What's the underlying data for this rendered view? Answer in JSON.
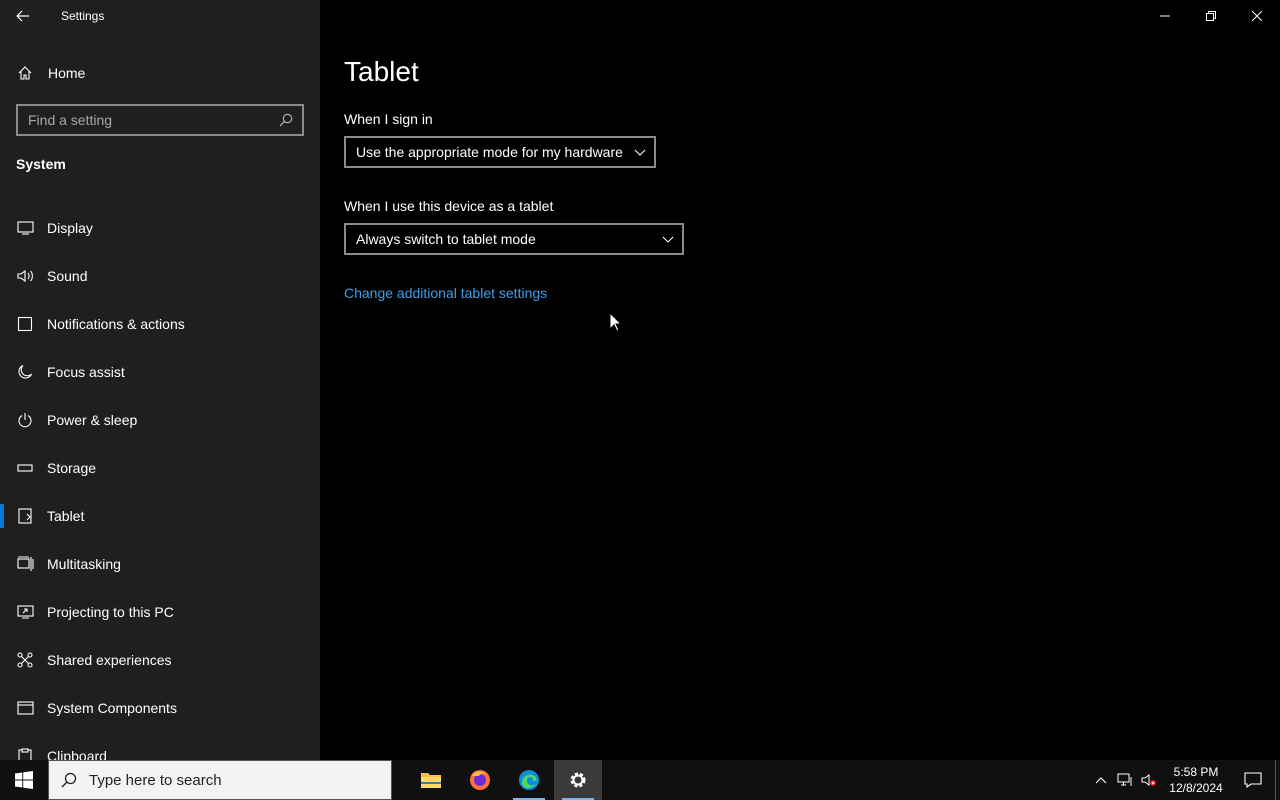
{
  "window": {
    "title": "Settings"
  },
  "sidebar": {
    "home_label": "Home",
    "search_placeholder": "Find a setting",
    "section": "System",
    "items": [
      {
        "label": "Display",
        "icon": "display-icon"
      },
      {
        "label": "Sound",
        "icon": "sound-icon"
      },
      {
        "label": "Notifications & actions",
        "icon": "notifications-icon"
      },
      {
        "label": "Focus assist",
        "icon": "moon-icon"
      },
      {
        "label": "Power & sleep",
        "icon": "power-icon"
      },
      {
        "label": "Storage",
        "icon": "storage-icon"
      },
      {
        "label": "Tablet",
        "icon": "tablet-icon",
        "selected": true
      },
      {
        "label": "Multitasking",
        "icon": "multitasking-icon"
      },
      {
        "label": "Projecting to this PC",
        "icon": "projecting-icon"
      },
      {
        "label": "Shared experiences",
        "icon": "shared-icon"
      },
      {
        "label": "System Components",
        "icon": "components-icon"
      },
      {
        "label": "Clipboard",
        "icon": "clipboard-icon"
      }
    ]
  },
  "main": {
    "title": "Tablet",
    "sign_in_label": "When I sign in",
    "sign_in_value": "Use the appropriate mode for my hardware",
    "tablet_label": "When I use this device as a tablet",
    "tablet_value": "Always switch to tablet mode",
    "link": "Change additional tablet settings"
  },
  "taskbar": {
    "search_placeholder": "Type here to search",
    "apps": [
      "file-explorer",
      "firefox",
      "edge",
      "settings"
    ],
    "time": "5:58 PM",
    "date": "12/8/2024"
  },
  "colors": {
    "accent": "#0078d7",
    "link": "#3f9ee6",
    "sidebar_bg": "#1f1f1f"
  }
}
